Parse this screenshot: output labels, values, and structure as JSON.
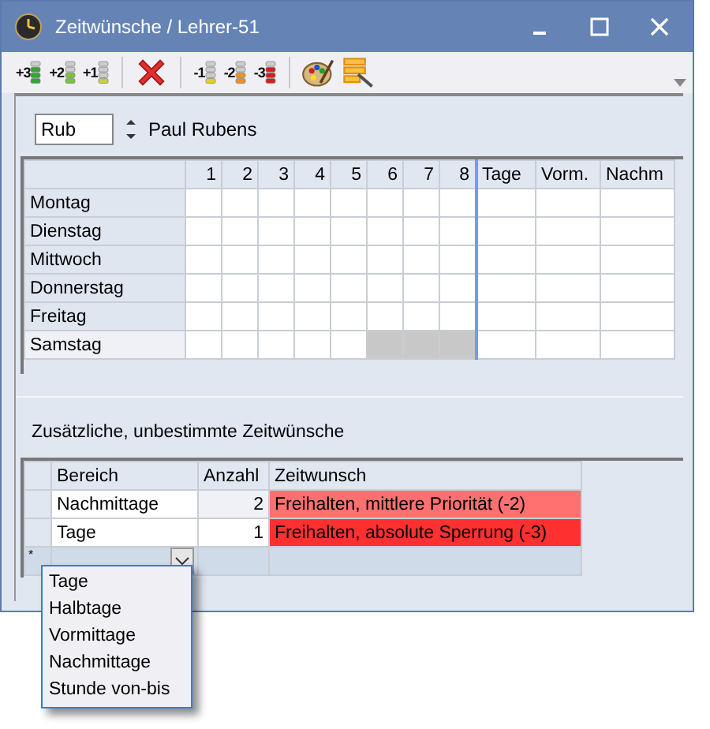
{
  "window": {
    "title": "Zeitwünsche / Lehrer-51"
  },
  "toolbar": [
    {
      "kind": "plus",
      "label": "+3"
    },
    {
      "kind": "plus",
      "label": "+2"
    },
    {
      "kind": "plus",
      "label": "+1"
    },
    {
      "kind": "delete"
    },
    {
      "kind": "minus",
      "label": "-1"
    },
    {
      "kind": "minus",
      "label": "-2"
    },
    {
      "kind": "minus",
      "label": "-3"
    },
    {
      "kind": "palette"
    },
    {
      "kind": "edit"
    }
  ],
  "teacher": {
    "value": "Rub",
    "name": "Paul Rubens"
  },
  "grid": {
    "columns": [
      "1",
      "2",
      "3",
      "4",
      "5",
      "6",
      "7",
      "8",
      "Tage",
      "Vorm.",
      "Nachm"
    ],
    "rows": [
      {
        "day": "Montag",
        "selected": false,
        "cells": [
          {
            "disabled": false
          },
          {
            "disabled": false
          },
          {
            "disabled": false
          },
          {
            "disabled": false
          },
          {
            "disabled": false
          },
          {
            "disabled": false
          },
          {
            "disabled": false
          },
          {
            "disabled": false
          }
        ]
      },
      {
        "day": "Dienstag",
        "selected": false,
        "cells": [
          {
            "disabled": false
          },
          {
            "disabled": false
          },
          {
            "disabled": false
          },
          {
            "disabled": false
          },
          {
            "disabled": false
          },
          {
            "disabled": false
          },
          {
            "disabled": false
          },
          {
            "disabled": false
          }
        ]
      },
      {
        "day": "Mittwoch",
        "selected": false,
        "cells": [
          {
            "disabled": false
          },
          {
            "disabled": false
          },
          {
            "disabled": false
          },
          {
            "disabled": false
          },
          {
            "disabled": false
          },
          {
            "disabled": false
          },
          {
            "disabled": false
          },
          {
            "disabled": false
          }
        ]
      },
      {
        "day": "Donnerstag",
        "selected": false,
        "cells": [
          {
            "disabled": false
          },
          {
            "disabled": false
          },
          {
            "disabled": false
          },
          {
            "disabled": false
          },
          {
            "disabled": false
          },
          {
            "disabled": false
          },
          {
            "disabled": false
          },
          {
            "disabled": false
          }
        ]
      },
      {
        "day": "Freitag",
        "selected": false,
        "cells": [
          {
            "disabled": false
          },
          {
            "disabled": false
          },
          {
            "disabled": false
          },
          {
            "disabled": false
          },
          {
            "disabled": false
          },
          {
            "disabled": false
          },
          {
            "disabled": false
          },
          {
            "disabled": false
          }
        ]
      },
      {
        "day": "Samstag",
        "selected": true,
        "cells": [
          {
            "disabled": false
          },
          {
            "disabled": false
          },
          {
            "disabled": false
          },
          {
            "disabled": false
          },
          {
            "disabled": false
          },
          {
            "disabled": true
          },
          {
            "disabled": true
          },
          {
            "disabled": true
          }
        ]
      }
    ]
  },
  "extra": {
    "title": "Zusätzliche, unbestimmte Zeitwünsche",
    "columns": [
      "Bereich",
      "Anzahl",
      "Zeitwunsch"
    ],
    "rows": [
      {
        "bereich": "Nachmittage",
        "anzahl": "2",
        "zeitwunsch": "Freihalten, mittlere Priorität (-2)",
        "color": "#ff7070",
        "focused": true
      },
      {
        "bereich": "Tage",
        "anzahl": "1",
        "zeitwunsch": "Freihalten, absolute Sperrung (-3)",
        "color": "#ff3030",
        "focused": false
      }
    ],
    "new_row_marker": "*"
  },
  "dropdown": {
    "items": [
      "Tage",
      "Halbtage",
      "Vormittage",
      "Nachmittage",
      "Stunde von-bis"
    ]
  }
}
